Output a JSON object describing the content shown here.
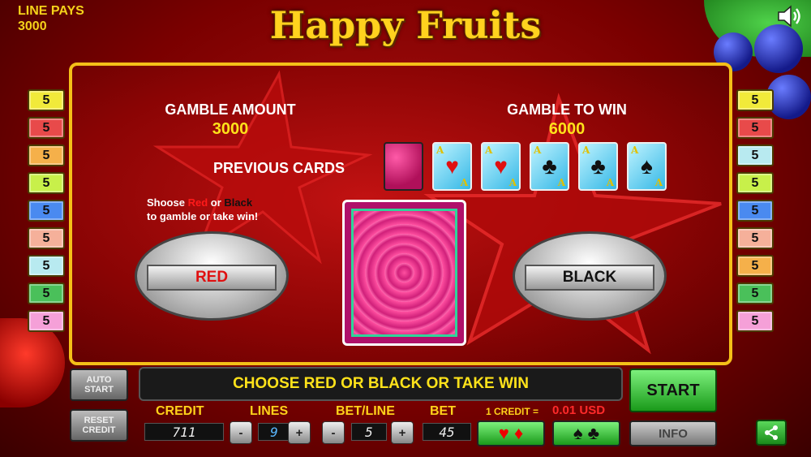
{
  "header": {
    "line_pays_label": "LINE PAYS",
    "line_pays_value": "3000",
    "title": "Happy Fruits"
  },
  "line_badges": {
    "left": [
      "5",
      "5",
      "5",
      "5",
      "5",
      "5",
      "5",
      "5",
      "5"
    ],
    "right": [
      "5",
      "5",
      "5",
      "5",
      "5",
      "5",
      "5",
      "5",
      "5"
    ],
    "left_colors": [
      "#f1ea3a",
      "#e84a4a",
      "#f5b04a",
      "#c8f04a",
      "#4a8af0",
      "#f5b09a",
      "#b8eaf0",
      "#4ac05a",
      "#f5a0d8"
    ],
    "right_colors": [
      "#f1ea3a",
      "#e84a4a",
      "#b8eaf0",
      "#c8f04a",
      "#4a8af0",
      "#f5b09a",
      "#f5b04a",
      "#4ac05a",
      "#f5a0d8"
    ]
  },
  "gamble": {
    "amount_label": "GAMBLE AMOUNT",
    "amount_value": "3000",
    "to_win_label": "GAMBLE TO WIN",
    "to_win_value": "6000",
    "previous_cards_label": "PREVIOUS CARDS",
    "hint_pre": "Shoose ",
    "hint_red": "Red",
    "hint_or": " or ",
    "hint_black": "Black",
    "hint_line2": "to gamble or take win!",
    "red_button": "RED",
    "black_button": "BLACK",
    "previous_cards": [
      {
        "rank": "",
        "suit": "card-back",
        "glyph": ""
      },
      {
        "rank": "A",
        "suit": "hearts",
        "glyph": "♥"
      },
      {
        "rank": "A",
        "suit": "hearts",
        "glyph": "♥"
      },
      {
        "rank": "A",
        "suit": "clubs",
        "glyph": "♣"
      },
      {
        "rank": "A",
        "suit": "clubs",
        "glyph": "♣"
      },
      {
        "rank": "A",
        "suit": "spades",
        "glyph": "♠"
      }
    ]
  },
  "controls": {
    "auto_start": "AUTO START",
    "reset_credit": "RESET CREDIT",
    "message": "CHOOSE RED OR BLACK OR TAKE WIN",
    "start": "START",
    "info": "INFO",
    "credit_label": "CREDIT",
    "credit_value": "711",
    "lines_label": "LINES",
    "lines_value": "9",
    "betline_label": "BET/LINE",
    "betline_value": "5",
    "bet_label": "BET",
    "bet_value": "45",
    "credit_rate_label": "1 CREDIT =",
    "credit_rate_value": "0.01 USD",
    "minus": "-",
    "plus": "+",
    "red_suits": "♥ ♦",
    "black_suits": "♠ ♣"
  },
  "colors": {
    "accent_yellow": "#ffd21a",
    "panel_border": "#f4c018",
    "start_green": "#3ac43a",
    "credit_rate_red": "#ff2a2a"
  }
}
